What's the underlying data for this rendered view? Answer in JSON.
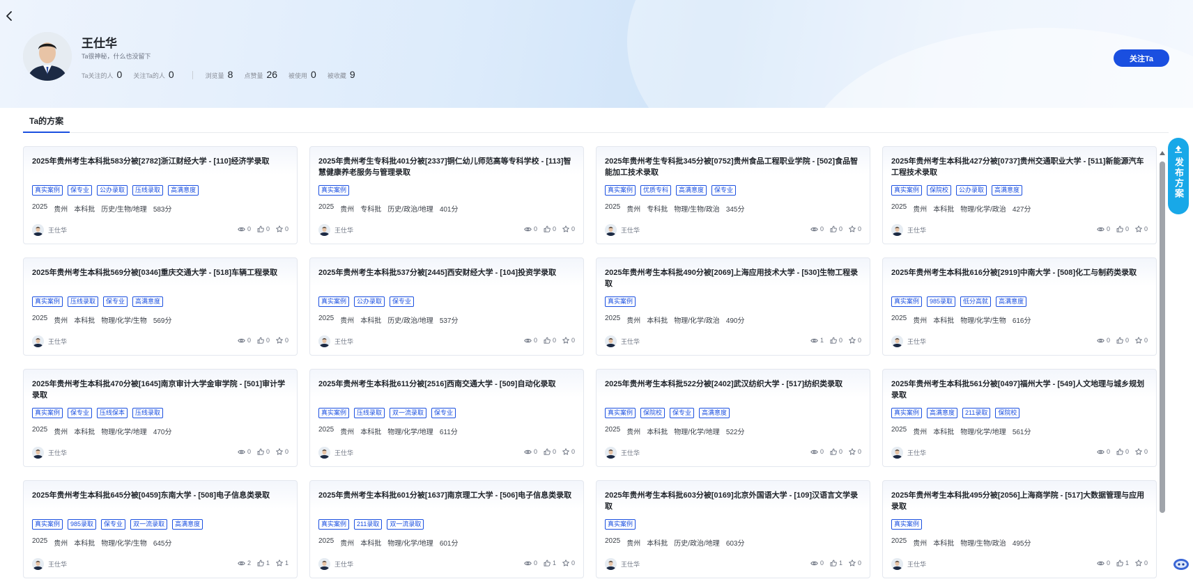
{
  "profile": {
    "name": "王仕华",
    "bio": "Ta很神秘，什么也没留下",
    "stats": [
      {
        "label": "Ta关注的人",
        "value": "0"
      },
      {
        "label": "关注Ta的人",
        "value": "0"
      },
      {
        "label": "浏览量",
        "value": "8"
      },
      {
        "label": "点赞量",
        "value": "26"
      },
      {
        "label": "被使用",
        "value": "0"
      },
      {
        "label": "被收藏",
        "value": "9"
      }
    ],
    "follow_label": "关注Ta"
  },
  "tabs": [
    {
      "label": "Ta的方案"
    }
  ],
  "publish_label": "发布方案",
  "cards": [
    {
      "title": "2025年贵州考生本科批583分被[2782]浙江财经大学 - [110]经济学录取",
      "tags": [
        "真实案例",
        "保专业",
        "公办录取",
        "压线录取",
        "高满意度"
      ],
      "meta": [
        "2025",
        "贵州",
        "本科批",
        "历史/生物/地理",
        "583分"
      ],
      "author": "王仕华",
      "views": "0",
      "likes": "0",
      "stars": "0"
    },
    {
      "title": "2025年贵州考生专科批401分被[2337]铜仁幼儿师范高等专科学校 - [113]智慧健康养老服务与管理录取",
      "tags": [
        "真实案例"
      ],
      "meta": [
        "2025",
        "贵州",
        "专科批",
        "历史/政治/地理",
        "401分"
      ],
      "author": "王仕华",
      "views": "0",
      "likes": "0",
      "stars": "0"
    },
    {
      "title": "2025年贵州考生专科批345分被[0752]贵州食品工程职业学院 - [502]食品智能加工技术录取",
      "tags": [
        "真实案例",
        "优质专科",
        "高满意度",
        "保专业"
      ],
      "meta": [
        "2025",
        "贵州",
        "专科批",
        "物理/生物/政治",
        "345分"
      ],
      "author": "王仕华",
      "views": "0",
      "likes": "0",
      "stars": "0"
    },
    {
      "title": "2025年贵州考生本科批427分被[0737]贵州交通职业大学 - [511]新能源汽车工程技术录取",
      "tags": [
        "真实案例",
        "保院校",
        "公办录取",
        "高满意度"
      ],
      "meta": [
        "2025",
        "贵州",
        "本科批",
        "物理/化学/政治",
        "427分"
      ],
      "author": "王仕华",
      "views": "0",
      "likes": "0",
      "stars": "0"
    },
    {
      "title": "2025年贵州考生本科批569分被[0346]重庆交通大学 - [518]车辆工程录取",
      "tags": [
        "真实案例",
        "压线录取",
        "保专业",
        "高满意度"
      ],
      "meta": [
        "2025",
        "贵州",
        "本科批",
        "物理/化学/生物",
        "569分"
      ],
      "author": "王仕华",
      "views": "0",
      "likes": "0",
      "stars": "0"
    },
    {
      "title": "2025年贵州考生本科批537分被[2445]西安财经大学 - [104]投资学录取",
      "tags": [
        "真实案例",
        "公办录取",
        "保专业"
      ],
      "meta": [
        "2025",
        "贵州",
        "本科批",
        "历史/政治/地理",
        "537分"
      ],
      "author": "王仕华",
      "views": "0",
      "likes": "0",
      "stars": "0"
    },
    {
      "title": "2025年贵州考生本科批490分被[2069]上海应用技术大学 - [530]生物工程录取",
      "tags": [
        "真实案例"
      ],
      "meta": [
        "2025",
        "贵州",
        "本科批",
        "物理/化学/政治",
        "490分"
      ],
      "author": "王仕华",
      "views": "1",
      "likes": "0",
      "stars": "0"
    },
    {
      "title": "2025年贵州考生本科批616分被[2919]中南大学 - [508]化工与制药类录取",
      "tags": [
        "真实案例",
        "985录取",
        "低分高就",
        "高满意度"
      ],
      "meta": [
        "2025",
        "贵州",
        "本科批",
        "物理/化学/生物",
        "616分"
      ],
      "author": "王仕华",
      "views": "0",
      "likes": "0",
      "stars": "0"
    },
    {
      "title": "2025年贵州考生本科批470分被[1645]南京审计大学金审学院 - [501]审计学录取",
      "tags": [
        "真实案例",
        "保专业",
        "压线保本",
        "压线录取"
      ],
      "meta": [
        "2025",
        "贵州",
        "本科批",
        "物理/化学/地理",
        "470分"
      ],
      "author": "王仕华",
      "views": "0",
      "likes": "0",
      "stars": "0"
    },
    {
      "title": "2025年贵州考生本科批611分被[2516]西南交通大学 - [509]自动化录取",
      "tags": [
        "真实案例",
        "压线录取",
        "双一流录取",
        "保专业"
      ],
      "meta": [
        "2025",
        "贵州",
        "本科批",
        "物理/化学/地理",
        "611分"
      ],
      "author": "王仕华",
      "views": "0",
      "likes": "0",
      "stars": "0"
    },
    {
      "title": "2025年贵州考生本科批522分被[2402]武汉纺织大学 - [517]纺织类录取",
      "tags": [
        "真实案例",
        "保院校",
        "保专业",
        "高满意度"
      ],
      "meta": [
        "2025",
        "贵州",
        "本科批",
        "物理/化学/地理",
        "522分"
      ],
      "author": "王仕华",
      "views": "0",
      "likes": "0",
      "stars": "0"
    },
    {
      "title": "2025年贵州考生本科批561分被[0497]福州大学 - [549]人文地理与城乡规划录取",
      "tags": [
        "真实案例",
        "高满意度",
        "211录取",
        "保院校"
      ],
      "meta": [
        "2025",
        "贵州",
        "本科批",
        "物理/化学/地理",
        "561分"
      ],
      "author": "王仕华",
      "views": "0",
      "likes": "0",
      "stars": "0"
    },
    {
      "title": "2025年贵州考生本科批645分被[0459]东南大学 - [508]电子信息类录取",
      "tags": [
        "真实案例",
        "985录取",
        "保专业",
        "双一流录取",
        "高满意度"
      ],
      "meta": [
        "2025",
        "贵州",
        "本科批",
        "物理/化学/生物",
        "645分"
      ],
      "author": "王仕华",
      "views": "2",
      "likes": "1",
      "stars": "1"
    },
    {
      "title": "2025年贵州考生本科批601分被[1637]南京理工大学 - [506]电子信息类录取",
      "tags": [
        "真实案例",
        "211录取",
        "双一流录取"
      ],
      "meta": [
        "2025",
        "贵州",
        "本科批",
        "物理/化学/地理",
        "601分"
      ],
      "author": "王仕华",
      "views": "0",
      "likes": "1",
      "stars": "0"
    },
    {
      "title": "2025年贵州考生本科批603分被[0169]北京外国语大学 - [109]汉语言文学录取",
      "tags": [
        "真实案例"
      ],
      "meta": [
        "2025",
        "贵州",
        "本科批",
        "历史/政治/地理",
        "603分"
      ],
      "author": "王仕华",
      "views": "0",
      "likes": "1",
      "stars": "0"
    },
    {
      "title": "2025年贵州考生本科批495分被[2056]上海商学院 - [517]大数据管理与应用录取",
      "tags": [
        "真实案例"
      ],
      "meta": [
        "2025",
        "贵州",
        "本科批",
        "物理/生物/政治",
        "495分"
      ],
      "author": "王仕华",
      "views": "0",
      "likes": "1",
      "stars": "0"
    }
  ]
}
